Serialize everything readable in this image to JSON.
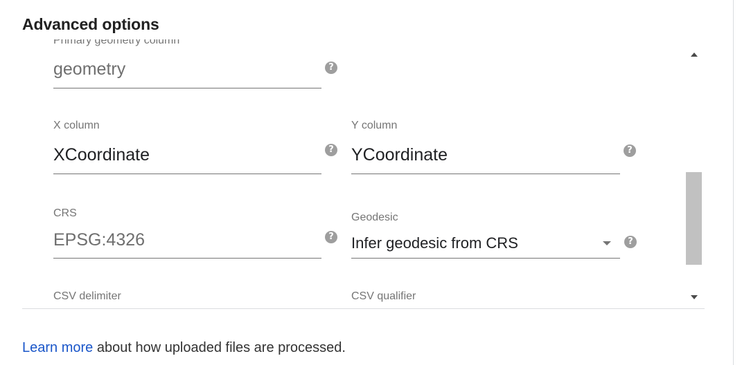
{
  "section": {
    "title": "Advanced options"
  },
  "fields": {
    "primary_geometry": {
      "label": "Primary geometry column",
      "value": "geometry"
    },
    "x_column": {
      "label": "X column",
      "value": "XCoordinate"
    },
    "y_column": {
      "label": "Y column",
      "value": "YCoordinate"
    },
    "crs": {
      "label": "CRS",
      "placeholder": "EPSG:4326"
    },
    "geodesic": {
      "label": "Geodesic",
      "selected": "Infer geodesic from CRS"
    },
    "csv_delimiter": {
      "label": "CSV delimiter"
    },
    "csv_qualifier": {
      "label": "CSV qualifier"
    }
  },
  "help_glyph": "?",
  "icons": {
    "help": "help-circle-icon",
    "dropdown": "triangle-down-icon",
    "scroll_up": "scroll-up-arrow-icon",
    "scroll_down": "scroll-down-arrow-icon"
  },
  "footer": {
    "link_text": "Learn more",
    "text": " about how uploaded files are processed."
  },
  "colors": {
    "link": "#1a56c9",
    "label": "#757575",
    "help_icon": "#9e9e9e",
    "scrollbar_thumb": "#c1c1c1"
  }
}
